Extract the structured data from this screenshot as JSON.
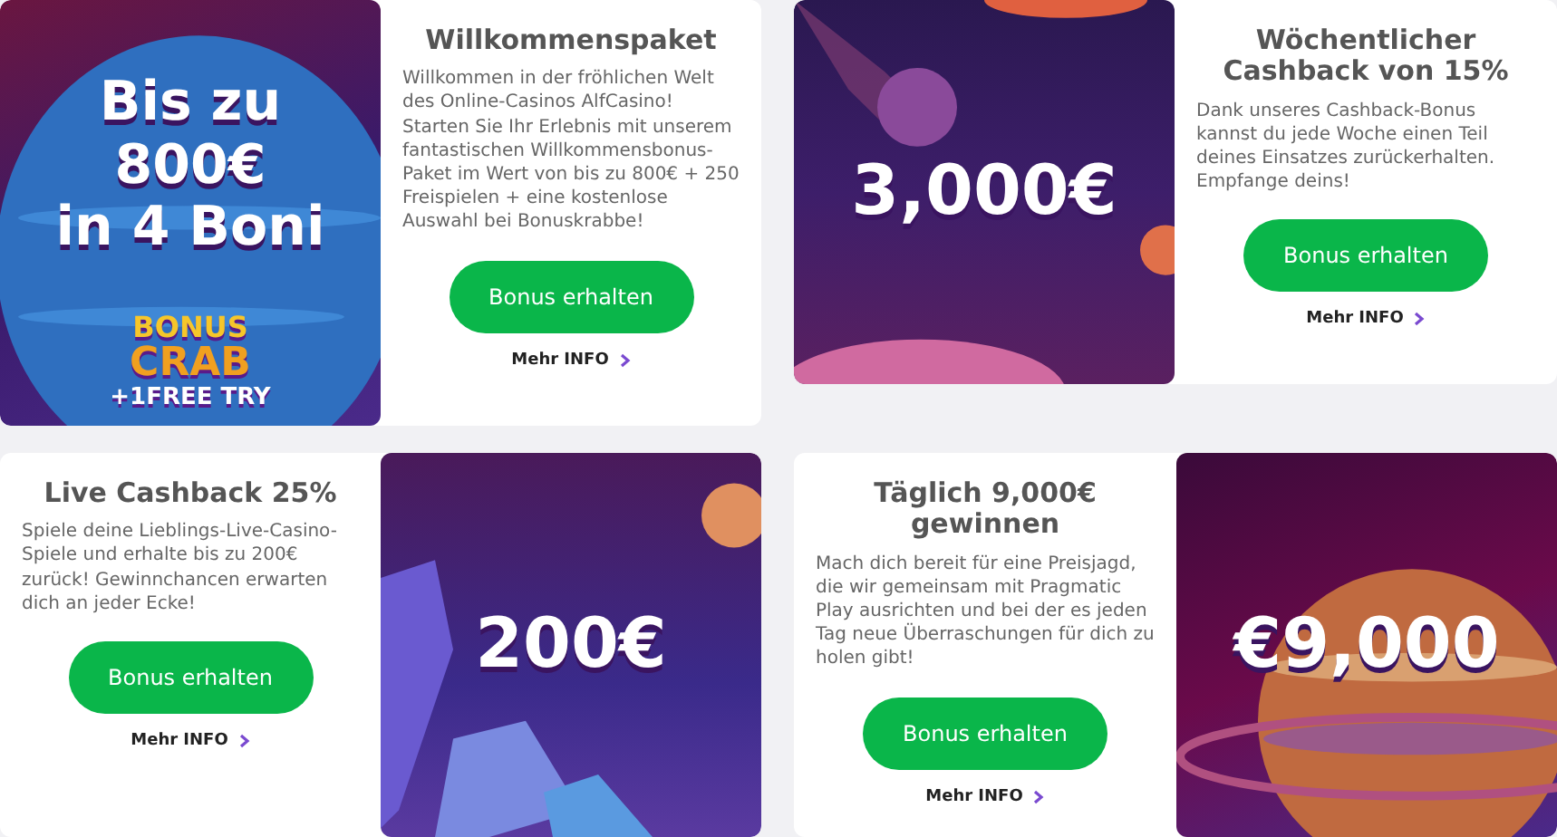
{
  "cards": [
    {
      "kind": "image-left",
      "image": {
        "kind": "planet",
        "lines": [
          "Bis zu",
          "800€",
          "in 4 Boni"
        ]
      },
      "badge": {
        "line1": "BONUS",
        "line2": "CRAB",
        "line3": "+1FREE TRY"
      },
      "title": "Willkommenspaket",
      "body": "Willkommen in der fröhlichen Welt des Online-Casinos AlfCasino! Starten Sie Ihr Erlebnis mit unserem fantastischen Willkommensbonus-Paket im Wert von bis zu 800€ + 250 Freispielen + eine kostenlose Auswahl bei Bonuskrabbe!",
      "button": "Bonus erhalten",
      "link": "Mehr INFO"
    },
    {
      "kind": "image-left",
      "image": {
        "kind": "comet",
        "lines": [
          "3,000€"
        ]
      },
      "title": "Wöchentlicher Cashback von 15%",
      "body": "Dank unseres Cashback-Bonus kannst du jede Woche einen Teil deines Einsatzes zurückerhalten. Empfange deins!",
      "button": "Bonus erhalten",
      "link": "Mehr INFO"
    },
    {
      "kind": "image-right",
      "image": {
        "kind": "crystal",
        "lines": [
          "200€"
        ]
      },
      "title": "Live Cashback 25%",
      "body": "Spiele deine Lieblings-Live-Casino-Spiele und erhalte bis zu 200€ zurück! Gewinnchancen erwarten dich an jeder Ecke!",
      "button": "Bonus erhalten",
      "link": "Mehr INFO"
    },
    {
      "kind": "image-right",
      "image": {
        "kind": "saturn",
        "lines": [
          "€9,000"
        ]
      },
      "title": "Täglich 9,000€ gewinnen",
      "body": "Mach dich bereit für eine Preisjagd, die wir gemeinsam mit Pragmatic Play ausrichten und bei der es jeden Tag neue Überraschungen für dich zu holen gibt!",
      "button": "Bonus erhalten",
      "link": "Mehr INFO"
    }
  ]
}
